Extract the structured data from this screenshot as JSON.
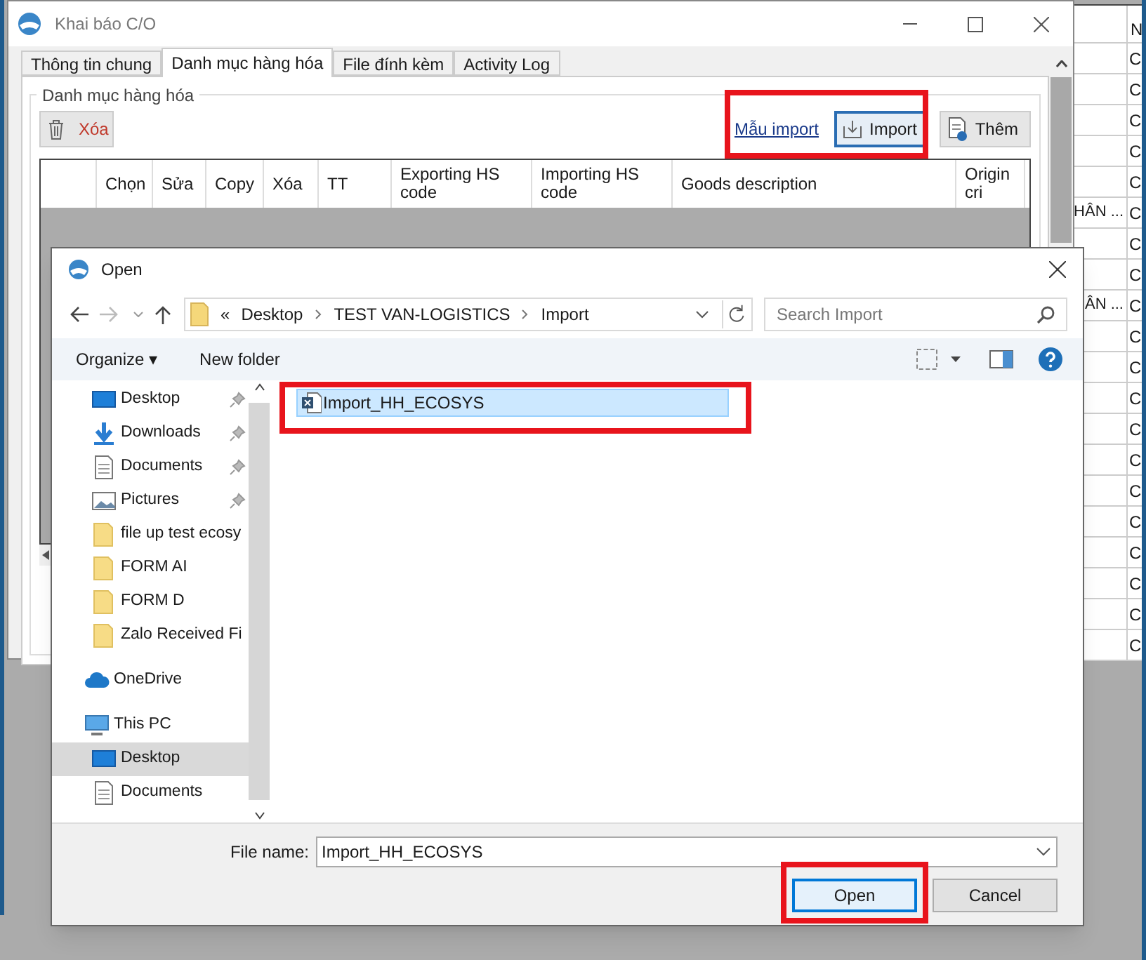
{
  "background_grid": {
    "header": "N",
    "rows": [
      {
        "column_1": "",
        "column_2": "C"
      },
      {
        "column_1": "",
        "column_2": "C"
      },
      {
        "column_1": "",
        "column_2": "C"
      },
      {
        "column_1": "",
        "column_2": "C"
      },
      {
        "column_1": "",
        "column_2": "C"
      },
      {
        "column_1": "HÂN ...",
        "column_2": "C"
      },
      {
        "column_1": "",
        "column_2": "C"
      },
      {
        "column_1": "",
        "column_2": "C"
      },
      {
        "column_1": "ÂN ...",
        "column_2": "C"
      },
      {
        "column_1": "",
        "column_2": "C"
      },
      {
        "column_1": "",
        "column_2": "C"
      },
      {
        "column_1": "",
        "column_2": "C"
      },
      {
        "column_1": "",
        "column_2": "C"
      },
      {
        "column_1": "",
        "column_2": "C"
      },
      {
        "column_1": "",
        "column_2": "C"
      },
      {
        "column_1": "",
        "column_2": "C"
      },
      {
        "column_1": "",
        "column_2": "C"
      },
      {
        "column_1": "",
        "column_2": "C"
      },
      {
        "column_1": "",
        "column_2": "C"
      },
      {
        "column_1": "",
        "column_2": "C"
      }
    ]
  },
  "window": {
    "title": "Khai báo C/O"
  },
  "tabs": [
    {
      "label": "Thông tin chung",
      "selected": false
    },
    {
      "label": "Danh mục hàng hóa",
      "selected": true
    },
    {
      "label": "File đính kèm",
      "selected": false
    },
    {
      "label": "Activity Log",
      "selected": false
    }
  ],
  "group_title": "Danh mục hàng hóa",
  "toolbar": [
    {
      "kind": "delete",
      "label": "Xóa"
    },
    {
      "kind": "link",
      "label": "Mẫu import"
    },
    {
      "kind": "import",
      "label": "Import"
    },
    {
      "kind": "add",
      "label": "Thêm"
    }
  ],
  "table": {
    "columns": [
      "",
      "Chọn",
      "Sửa",
      "Copy",
      "Xóa",
      "TT",
      "Exporting HS code",
      "Importing HS code",
      "Goods description",
      "Origin cri"
    ]
  },
  "dialog": {
    "title": "Open",
    "breadcrumb": [
      "«",
      "Desktop",
      "TEST VAN-LOGISTICS",
      "Import"
    ],
    "search": {
      "placeholder": "Search Import"
    },
    "commands": [
      "Organize ▾",
      "New folder"
    ],
    "quick_access": [
      {
        "label": "Desktop",
        "kind": "desktop",
        "pinned": true
      },
      {
        "label": "Downloads",
        "kind": "downloads",
        "pinned": true
      },
      {
        "label": "Documents",
        "kind": "documents",
        "pinned": true
      },
      {
        "label": "Pictures",
        "kind": "pictures",
        "pinned": true
      },
      {
        "label": "file up test ecosy",
        "kind": "folder",
        "pinned": false
      },
      {
        "label": "FORM AI",
        "kind": "folder",
        "pinned": false
      },
      {
        "label": "FORM D",
        "kind": "folder",
        "pinned": false
      },
      {
        "label": "Zalo Received Fi",
        "kind": "folder",
        "pinned": false
      }
    ],
    "locations": [
      {
        "label": "OneDrive",
        "kind": "cloud",
        "selected": false
      },
      {
        "label": "This PC",
        "kind": "pc",
        "selected": false,
        "children": [
          {
            "label": "Desktop",
            "kind": "desktop",
            "selected": true
          },
          {
            "label": "Documents",
            "kind": "documents",
            "selected": false
          }
        ]
      }
    ],
    "files": [
      {
        "name": "Import_HH_ECOSYS",
        "selected": true
      }
    ],
    "file_name": {
      "label": "File name:",
      "value": "Import_HH_ECOSYS"
    },
    "buttons": [
      {
        "label": "Open",
        "default": true
      },
      {
        "label": "Cancel",
        "default": false
      }
    ]
  }
}
